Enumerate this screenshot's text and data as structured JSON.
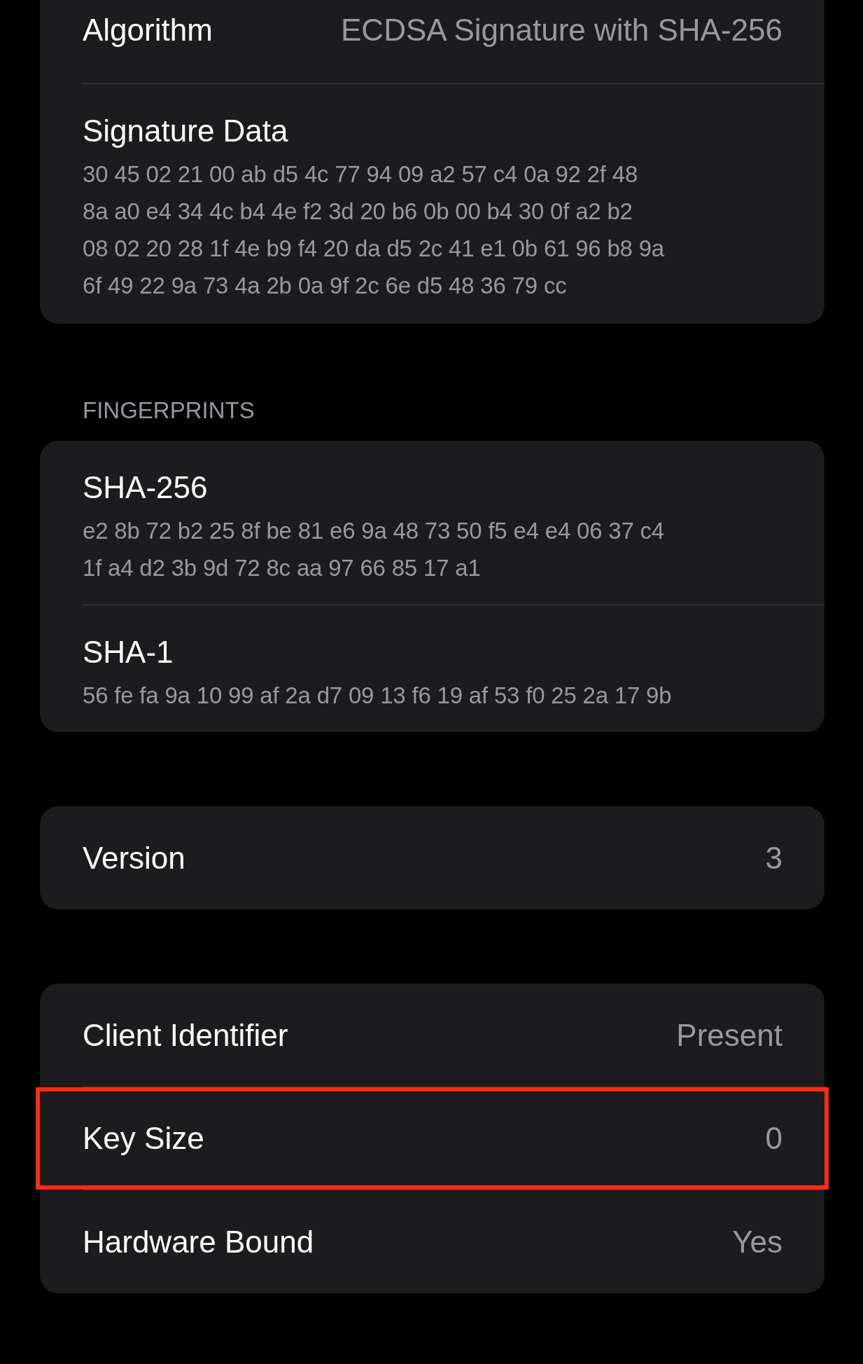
{
  "signature_section": {
    "algorithm": {
      "label": "Algorithm",
      "value": "ECDSA Signature with SHA-256"
    },
    "signature_data": {
      "label": "Signature Data",
      "lines": [
        "30 45 02 21 00 ab d5 4c 77 94 09 a2 57 c4 0a 92 2f 48",
        "8a a0 e4 34 4c b4 4e f2 3d 20 b6 0b 00 b4 30 0f a2 b2",
        "08 02 20 28 1f 4e b9 f4 20 da d5 2c 41 e1 0b 61 96 b8 9a",
        "6f 49 22 9a 73 4a 2b 0a 9f 2c 6e d5 48 36 79 cc"
      ]
    }
  },
  "fingerprints": {
    "header": "FINGERPRINTS",
    "items": [
      {
        "label": "SHA-256",
        "lines": [
          "e2 8b 72 b2 25 8f be 81 e6 9a 48 73 50 f5 e4 e4 06 37 c4",
          "1f a4 d2 3b 9d 72 8c aa 97 66 85 17 a1"
        ]
      },
      {
        "label": "SHA-1",
        "lines": [
          "56 fe fa 9a 10 99 af 2a d7 09 13 f6 19 af 53 f0 25 2a 17 9b"
        ]
      }
    ]
  },
  "version": {
    "label": "Version",
    "value": "3"
  },
  "key_info": [
    {
      "label": "Client Identifier",
      "value": "Present",
      "highlighted": false
    },
    {
      "label": "Key Size",
      "value": "0",
      "highlighted": true
    },
    {
      "label": "Hardware Bound",
      "value": "Yes",
      "highlighted": false
    }
  ]
}
